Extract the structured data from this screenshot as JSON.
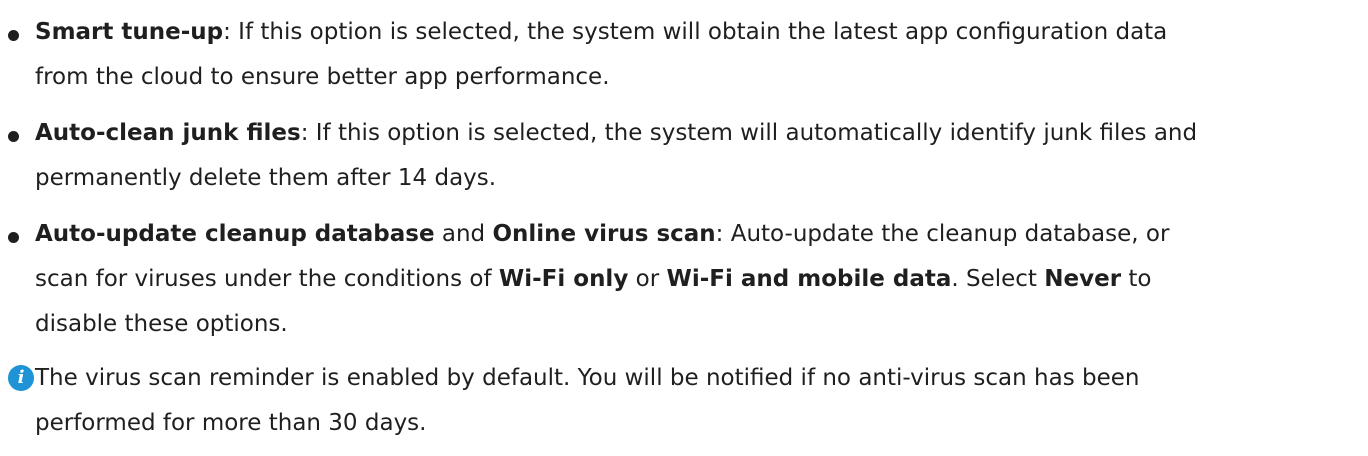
{
  "items": [
    {
      "line1": {
        "bold1": "Smart tune-up",
        "text1": ": If this option is selected, the system will obtain the latest app configuration data"
      },
      "line2": "from the cloud to ensure better app performance."
    },
    {
      "line1": {
        "bold1": "Auto-clean junk files",
        "text1": ": If this option is selected, the system will automatically identify junk files and"
      },
      "line2": "permanently delete them after 14 days."
    },
    {
      "line1": {
        "bold1": "Auto-update cleanup database",
        "text1": " and ",
        "bold2": "Online virus scan",
        "text2": ": Auto-update the cleanup database, or"
      },
      "line2": {
        "text1": "scan for viruses under the conditions of ",
        "bold1": "Wi-Fi only",
        "text2": " or ",
        "bold2": "Wi-Fi and mobile data",
        "text3": ". Select ",
        "bold3": "Never",
        "text4": " to"
      },
      "line3": "disable these options."
    }
  ],
  "note": {
    "icon": "info-icon",
    "icon_glyph": "i",
    "line1": "The virus scan reminder is enabled by default. You will be notified if no anti-virus scan has been",
    "line2": "performed for more than 30 days."
  }
}
